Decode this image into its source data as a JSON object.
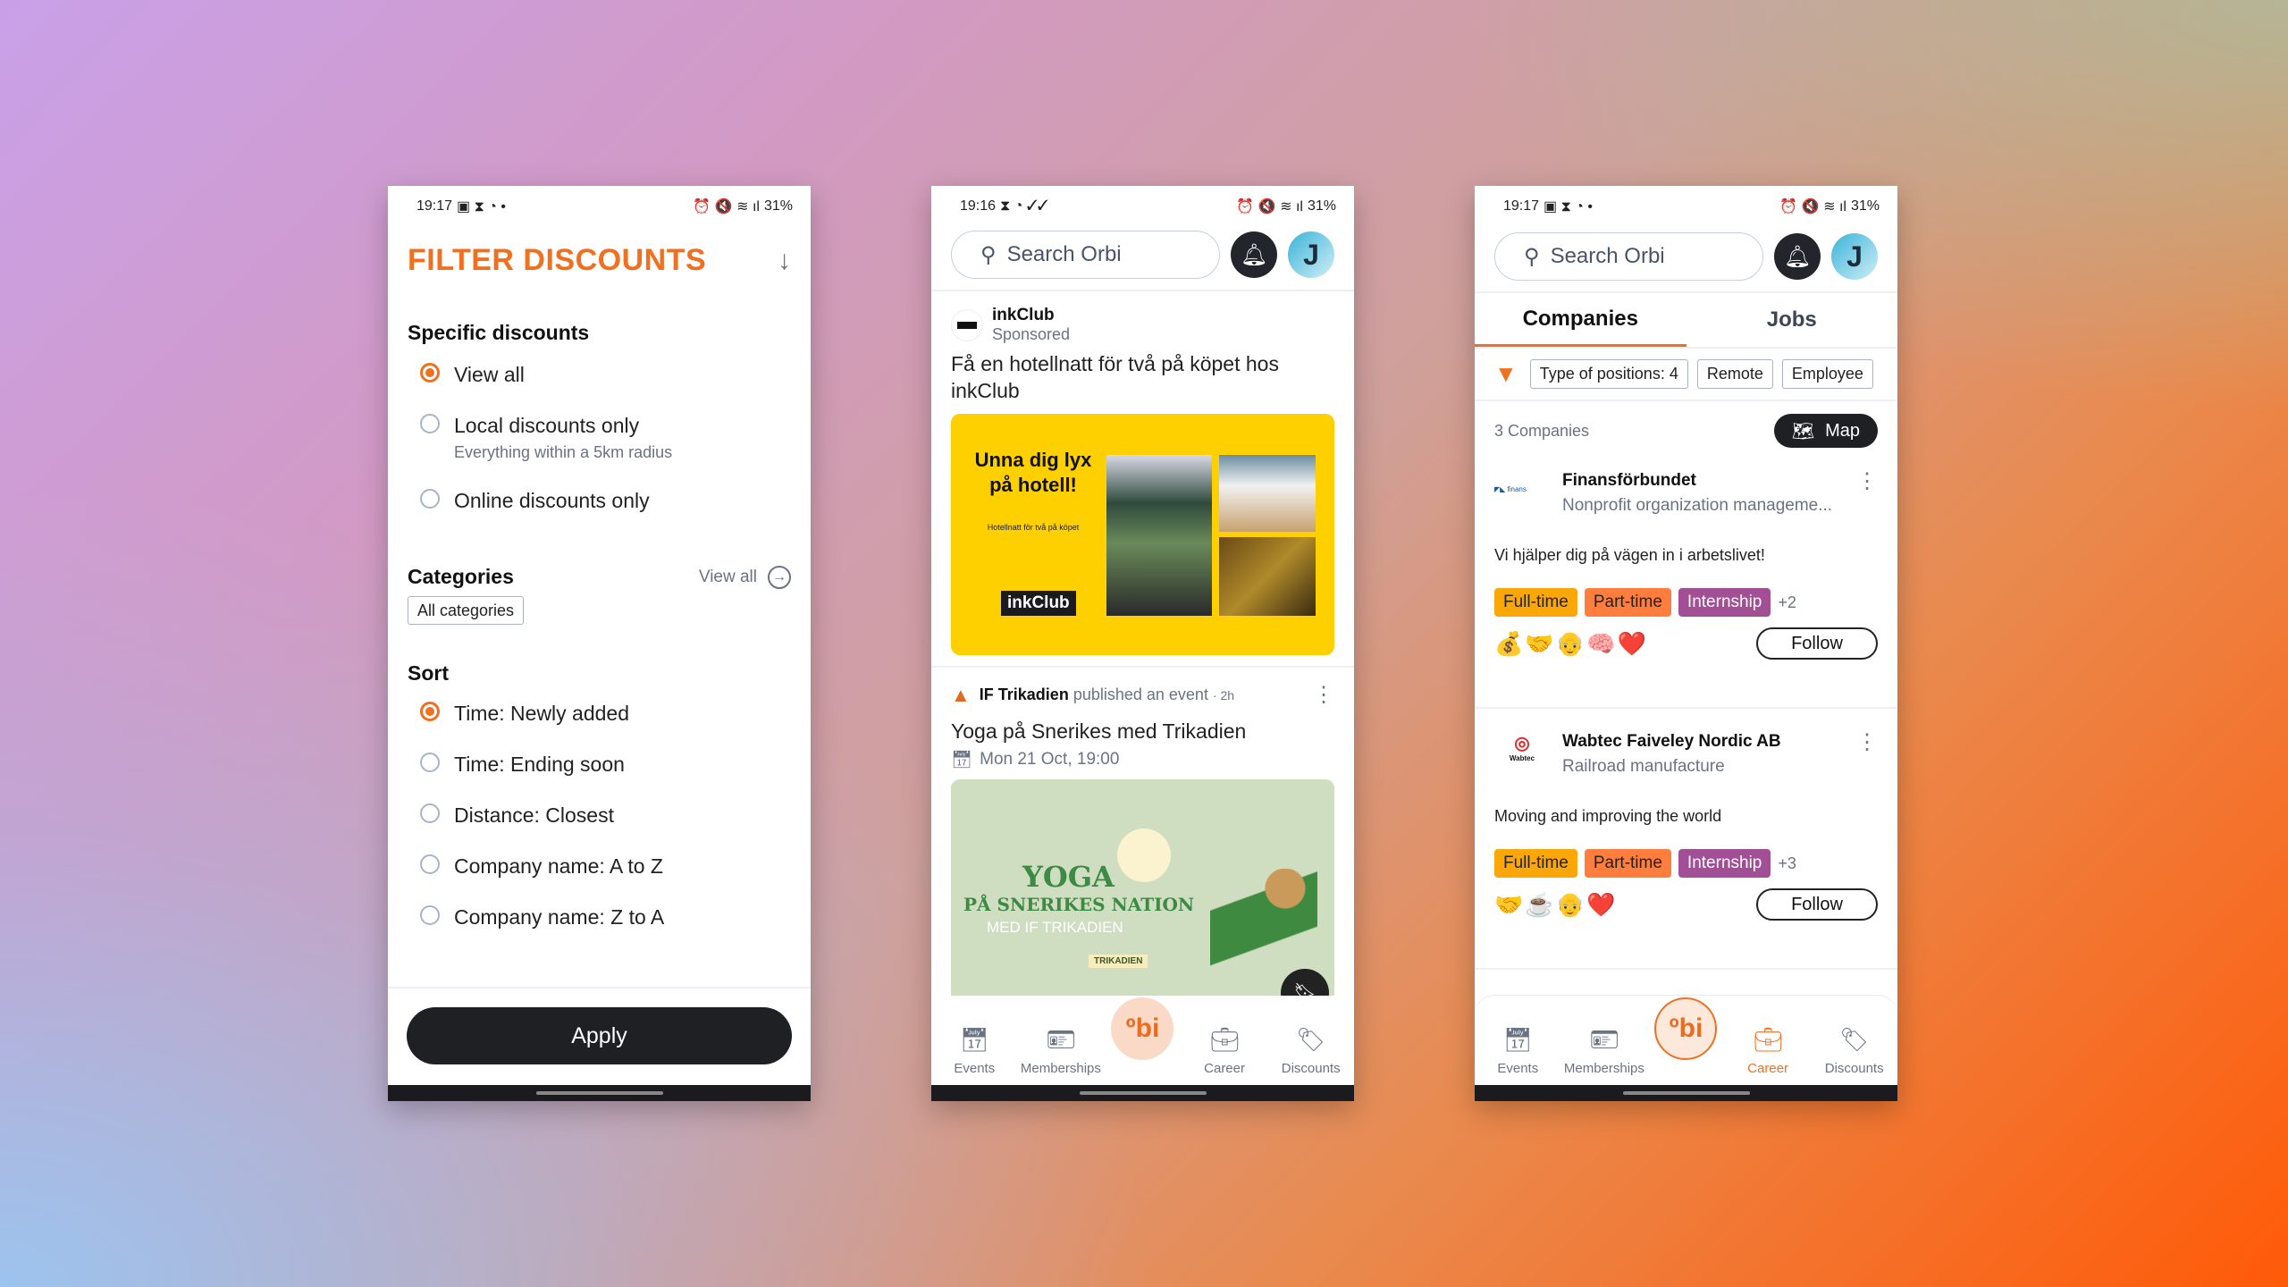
{
  "phone1": {
    "status": {
      "time": "19:17",
      "battery": "31%"
    },
    "title": "FILTER DISCOUNTS",
    "specific": {
      "heading": "Specific discounts",
      "options": [
        {
          "label": "View all",
          "sub": "",
          "selected": true
        },
        {
          "label": "Local discounts only",
          "sub": "Everything within a 5km radius",
          "selected": false
        },
        {
          "label": "Online discounts only",
          "sub": "",
          "selected": false
        }
      ]
    },
    "categories": {
      "heading": "Categories",
      "view_all": "View all",
      "chip": "All categories"
    },
    "sort": {
      "heading": "Sort",
      "options": [
        {
          "label": "Time: Newly added",
          "selected": true
        },
        {
          "label": "Time: Ending soon",
          "selected": false
        },
        {
          "label": "Distance: Closest",
          "selected": false
        },
        {
          "label": "Company name: A to Z",
          "selected": false
        },
        {
          "label": "Company name: Z to A",
          "selected": false
        }
      ]
    },
    "apply": "Apply"
  },
  "phone2": {
    "status": {
      "time": "19:16",
      "battery": "31%"
    },
    "search_placeholder": "Search Orbi",
    "avatar": "J",
    "post1": {
      "author": "inkClub",
      "meta": "Sponsored",
      "text": "Få en hotellnatt för två på köpet hos inkClub",
      "ad": {
        "headline": "Unna dig lyx på hotell!",
        "sub": "Hotellnatt för två på köpet",
        "logo": "inkClub"
      }
    },
    "post2": {
      "author": "IF Trikadien",
      "action": "published an event",
      "age": "· 2h",
      "title": "Yoga på Snerikes med Trikadien",
      "date": "Mon 21 Oct, 19:00",
      "poster": {
        "l1": "YOGA",
        "l2": "PÅ SNERIKES NATION",
        "l3": "MED IF TRIKADIEN",
        "ig": "TRIKADIEN"
      }
    },
    "nav": [
      {
        "label": "Events"
      },
      {
        "label": "Memberships"
      },
      {
        "label": "Career"
      },
      {
        "label": "Discounts"
      }
    ],
    "nav_center": "orbi"
  },
  "phone3": {
    "status": {
      "time": "19:17",
      "battery": "31%"
    },
    "search_placeholder": "Search Orbi",
    "avatar": "J",
    "tabs": [
      {
        "label": "Companies",
        "active": true
      },
      {
        "label": "Jobs",
        "active": false
      }
    ],
    "filters": [
      "Type of positions: 4",
      "Remote",
      "Employee"
    ],
    "count": "3 Companies",
    "map": "Map",
    "companies": [
      {
        "name": "Finansförbundet",
        "category": "Nonprofit organization manageme...",
        "tagline": "Vi hjälper dig på vägen in i arbetslivet!",
        "tags": [
          "Full-time",
          "Part-time",
          "Internship"
        ],
        "more": "+2",
        "emojis": [
          "💰",
          "🤝",
          "👴",
          "🧠",
          "❤️"
        ],
        "follow": "Follow"
      },
      {
        "name": "Wabtec Faiveley Nordic AB",
        "category": "Railroad manufacture",
        "tagline": "Moving and improving the world",
        "tags": [
          "Full-time",
          "Part-time",
          "Internship"
        ],
        "more": "+3",
        "emojis": [
          "🤝",
          "☕",
          "👴",
          "❤️"
        ],
        "follow": "Follow"
      }
    ],
    "nav": [
      {
        "label": "Events"
      },
      {
        "label": "Memberships"
      },
      {
        "label": "Career"
      },
      {
        "label": "Discounts"
      }
    ],
    "active_nav": "Career"
  },
  "colors": {
    "accent": "#f07020",
    "dark": "#1f2024"
  }
}
